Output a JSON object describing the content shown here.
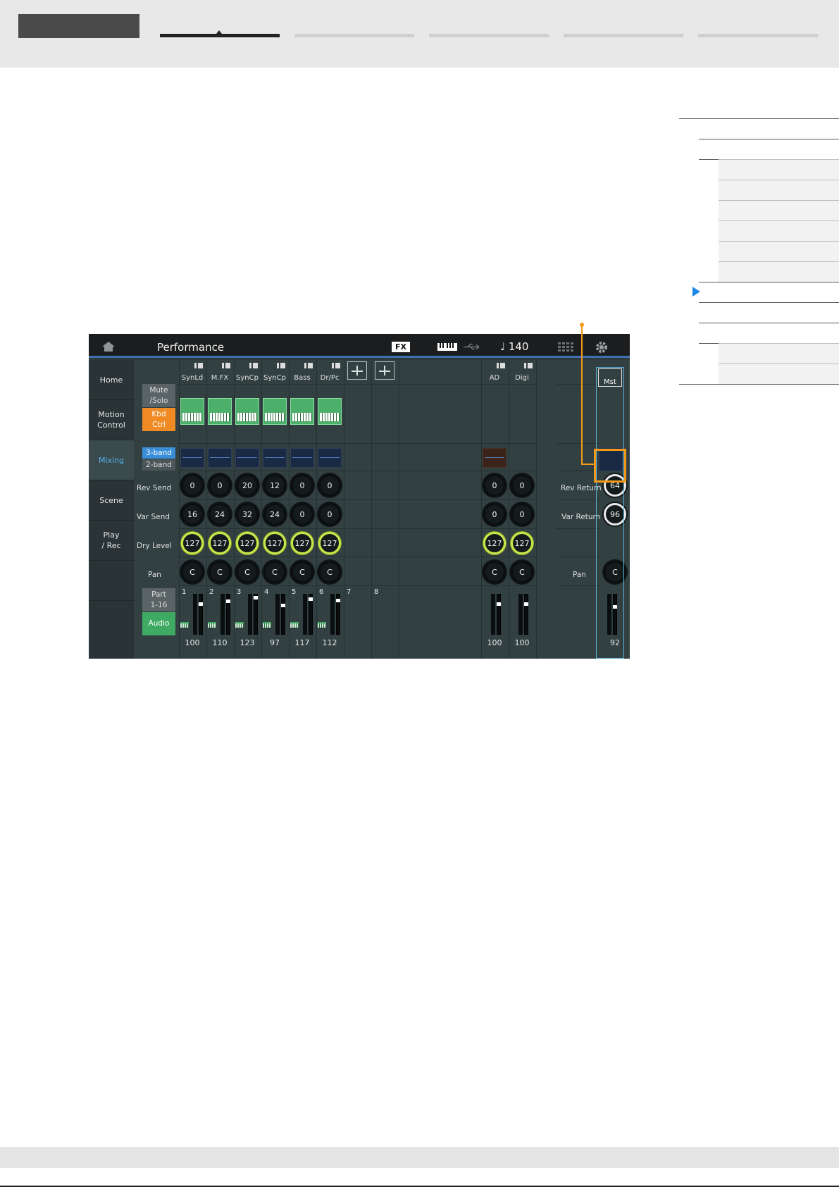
{
  "screen": {
    "title": "Performance",
    "fx_badge": "FX",
    "tempo": "♩ 140",
    "left_nav": [
      "Home",
      "Motion\nControl",
      "Mixing",
      "Scene",
      "Play\n/ Rec"
    ],
    "active_nav": "Mixing",
    "part_names": [
      "SynLd",
      "M.FX",
      "SynCp",
      "SynCp",
      "Bass",
      "Dr/Pc"
    ],
    "audio_names": [
      "AD",
      "Digi"
    ],
    "master_name": "Mst",
    "buttons": {
      "mute_solo": "Mute\n/Solo",
      "kbd_ctrl": "Kbd\nCtrl",
      "three_band": "3-band",
      "two_band": "2-band",
      "part_range": "Part\n1-16",
      "audio": "Audio"
    },
    "row_labels": {
      "rev_send": "Rev Send",
      "var_send": "Var Send",
      "dry_level": "Dry Level",
      "pan": "Pan",
      "rev_return": "Rev Return",
      "var_return": "Var Return",
      "pan_master": "Pan"
    },
    "rev_send": [
      "0",
      "0",
      "20",
      "12",
      "0",
      "0"
    ],
    "var_send": [
      "16",
      "24",
      "32",
      "24",
      "0",
      "0"
    ],
    "dry_level": [
      "127",
      "127",
      "127",
      "127",
      "127",
      "127"
    ],
    "pan": [
      "C",
      "C",
      "C",
      "C",
      "C",
      "C"
    ],
    "audio_rev_send": [
      "0",
      "0"
    ],
    "audio_var_send": [
      "0",
      "0"
    ],
    "audio_dry_level": [
      "127",
      "127"
    ],
    "audio_pan": [
      "C",
      "C"
    ],
    "rev_return": "64",
    "var_return": "96",
    "master_pan": "C",
    "part_numbers": [
      "1",
      "2",
      "3",
      "4",
      "5",
      "6",
      "7",
      "8"
    ],
    "volumes": [
      "100",
      "110",
      "123",
      "97",
      "117",
      "112"
    ],
    "audio_volumes": [
      "100",
      "100"
    ],
    "master_volume": "92"
  },
  "colors": {
    "accent_orange": "#f39a1a",
    "active_blue": "#54b4f0",
    "dry_green": "#c8e64a",
    "toc_marker": "#1e88e5"
  }
}
